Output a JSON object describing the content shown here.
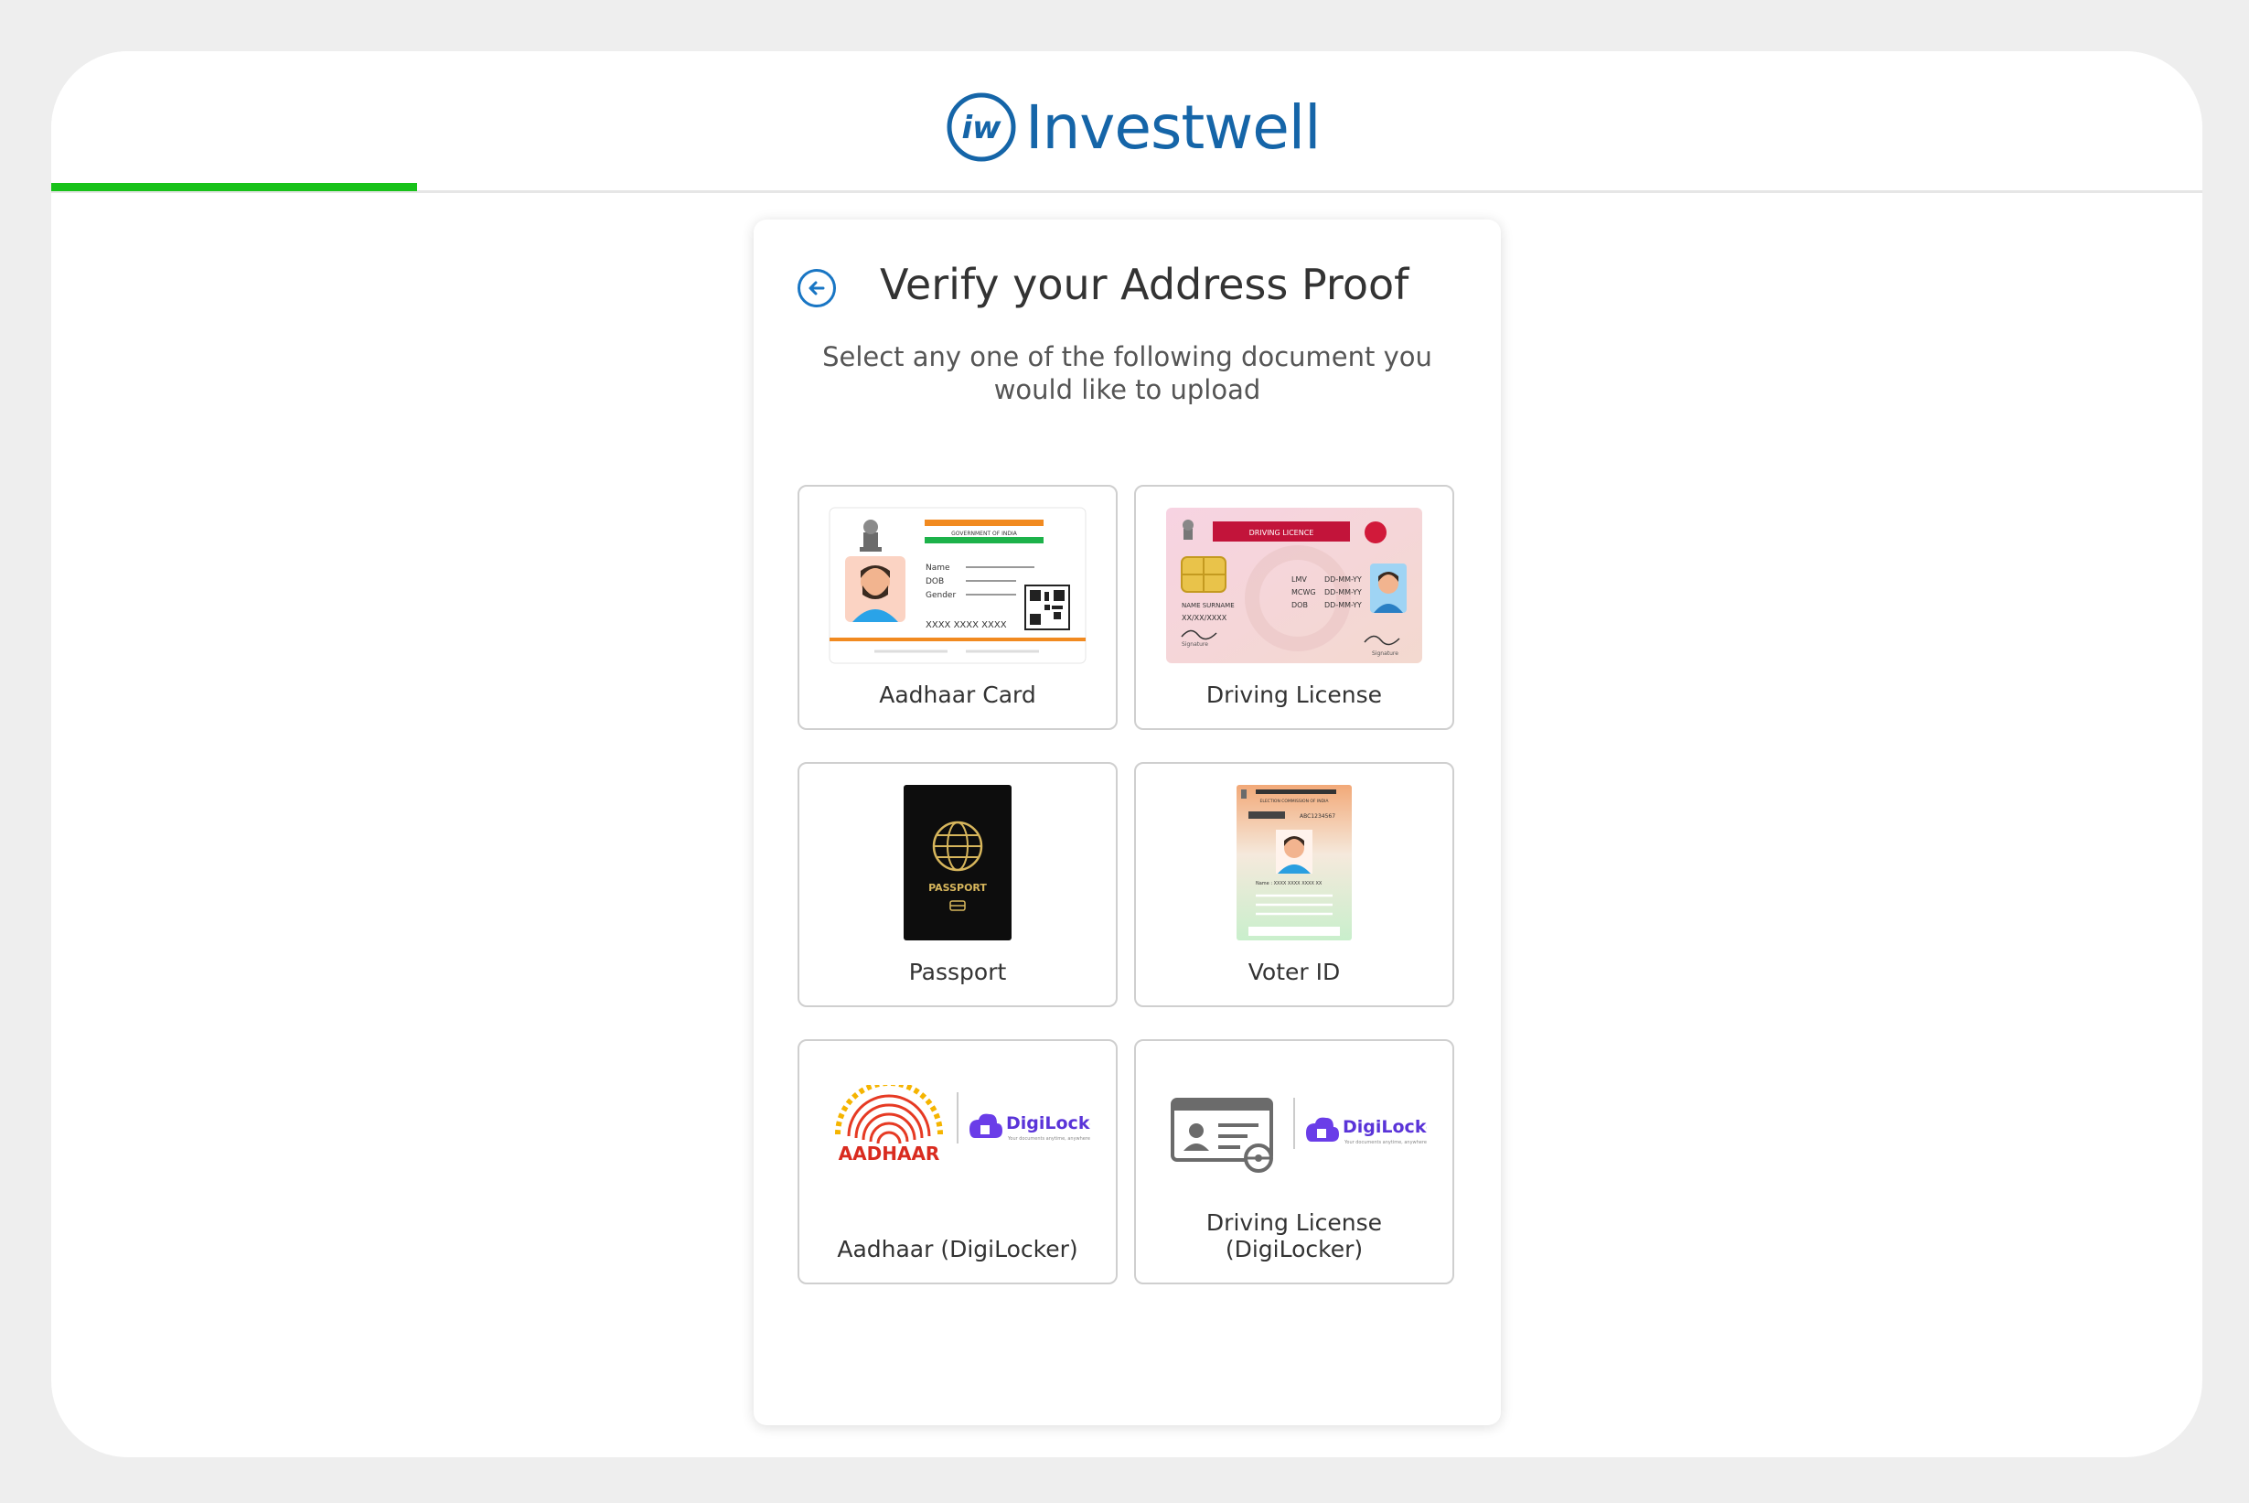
{
  "brand": {
    "name": "Investwell",
    "mark_text": "iw",
    "color": "#1565a8"
  },
  "progress": {
    "value_fraction": 0.17,
    "color": "#18c21a"
  },
  "page": {
    "title": "Verify your Address Proof",
    "subtitle": "Select any one of the following document you would like to upload"
  },
  "documents": [
    {
      "label": "Aadhaar Card",
      "icon": "aadhaar-card-image"
    },
    {
      "label": "Driving License",
      "icon": "driving-license-image"
    },
    {
      "label": "Passport",
      "icon": "passport-image"
    },
    {
      "label": "Voter ID",
      "icon": "voter-id-image"
    },
    {
      "label": "Aadhaar (DigiLocker)",
      "icon": "aadhaar-digilocker-logo"
    },
    {
      "label": "Driving License (DigiLocker)",
      "icon": "license-digilocker-logo"
    }
  ],
  "card_art": {
    "aadhaar": {
      "gov": "GOVERNMENT OF INDIA",
      "f1": "Name",
      "f2": "DOB",
      "f3": "Gender",
      "number": "XXXX XXXX XXXX"
    },
    "license": {
      "banner": "DRIVING LICENCE",
      "c1": "LMV",
      "c2": "MCWG",
      "c3": "DOB",
      "date": "DD-MM-YY",
      "name": "NAME SURNAME",
      "id": "XX/XX/XXXX",
      "sig": "Signature"
    },
    "passport": {
      "label": "PASSPORT"
    },
    "voter": {
      "header": "ELECTION COMMISSION OF INDIA",
      "id": "ABC1234567",
      "name": "Name : XXXX XXXX XXXX XX"
    },
    "digilocker": {
      "name": "DigiLocker",
      "tagline": "Your documents anytime, anywhere",
      "aadhaar_word": "AADHAAR"
    }
  }
}
